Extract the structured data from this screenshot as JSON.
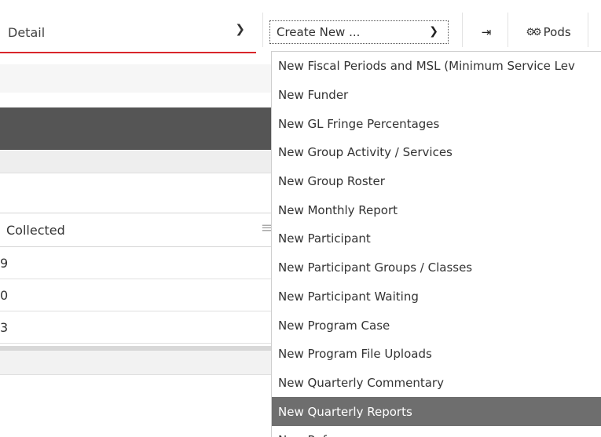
{
  "toolbar": {
    "detail_select_label": "Detail",
    "create_select_label": "Create New ...",
    "logout_icon": "sign-out-icon",
    "pods_label": "Pods",
    "pods_icon": "gears-icon"
  },
  "table": {
    "column_header": "Collected",
    "rows": [
      "9",
      "0",
      "3"
    ]
  },
  "dropdown": {
    "options": [
      "New Fiscal Periods and MSL (Minimum Service Lev",
      "New Funder",
      "New GL Fringe Percentages",
      "New Group Activity / Services",
      "New Group Roster",
      "New Monthly Report",
      "New Participant",
      "New Participant Groups / Classes",
      "New Participant Waiting",
      "New Program Case",
      "New Program File Uploads",
      "New Quarterly Commentary",
      "New Quarterly Reports",
      "New Reference"
    ],
    "selected_index": 12
  },
  "colors": {
    "accent_red": "#d9262b",
    "dark_header": "#555555",
    "selected_option": "#6e6e6e"
  }
}
